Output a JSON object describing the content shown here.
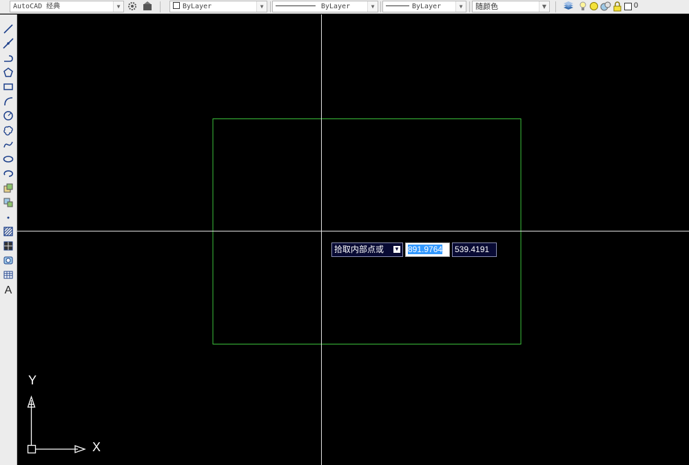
{
  "toolbar": {
    "workspace": "AutoCAD 经典",
    "color_control": "ByLayer",
    "linetype_control": "ByLayer",
    "lineweight_control": "ByLayer",
    "plotstyle_control": "随颜色",
    "layer_value": "0"
  },
  "draw_toolbar": {
    "items": [
      "line-icon",
      "construction-line-icon",
      "polyline-icon",
      "polygon-icon",
      "rectangle-icon",
      "arc-icon",
      "circle-icon",
      "revision-cloud-icon",
      "spline-icon",
      "ellipse-icon",
      "ellipse-arc-icon",
      "insert-block-icon",
      "make-block-icon",
      "point-icon",
      "hatch-icon",
      "gradient-icon",
      "region-icon",
      "table-icon",
      "multiline-text-icon"
    ],
    "text_tool_label": "A"
  },
  "dynamic_input": {
    "prompt": "拾取内部点或",
    "x_value": "891.9764",
    "y_value": "539.4191"
  },
  "ucs": {
    "x_label": "X",
    "y_label": "Y"
  },
  "colors": {
    "canvas": "#000000",
    "crosshair": "#ffffff",
    "rectangle": "#3cc33c",
    "dyn_bg": "#080a33",
    "highlight": "#3399ff"
  }
}
